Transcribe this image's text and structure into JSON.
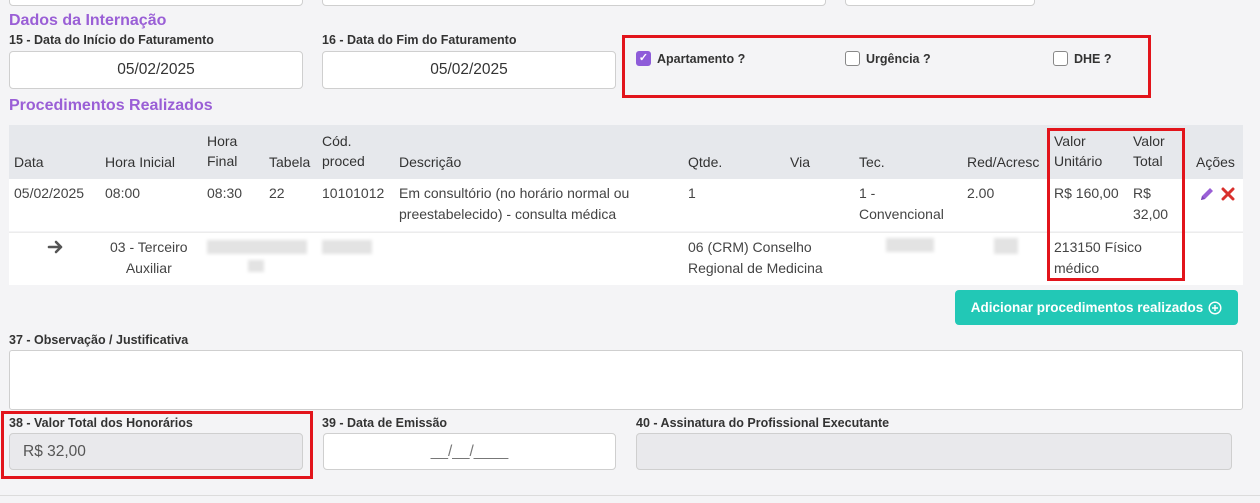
{
  "sections": {
    "internacao_title": "Dados da Internação",
    "procedimentos_title": "Procedimentos Realizados"
  },
  "fields": {
    "inicio_label": "15 - Data do Início do Faturamento",
    "inicio_value": "05/02/2025",
    "fim_label": "16 - Data do Fim do Faturamento",
    "fim_value": "05/02/2025",
    "obs_label": "37 - Observação / Justificativa",
    "obs_value": "",
    "valor_total_label": "38 - Valor Total dos Honorários",
    "valor_total_value": "R$ 32,00",
    "emissao_label": "39 - Data de Emissão",
    "emissao_value": "__/__/____",
    "assinatura_label": "40 - Assinatura do Profissional Executante",
    "assinatura_value": ""
  },
  "checkboxes": {
    "apartamento": {
      "label": "Apartamento ?",
      "checked": true
    },
    "urgencia": {
      "label": "Urgência ?",
      "checked": false
    },
    "dhe": {
      "label": "DHE ?",
      "checked": false
    }
  },
  "table": {
    "headers": {
      "data": "Data",
      "hora_inicial": "Hora Inicial",
      "hora_final_1": "Hora",
      "hora_final_2": "Final",
      "tabela": "Tabela",
      "cod_1": "Cód.",
      "cod_2": "proced",
      "descricao": "Descrição",
      "qtde": "Qtde.",
      "via": "Via",
      "tec": "Tec.",
      "red": "Red/Acresc",
      "valor_unit_1": "Valor",
      "valor_unit_2": "Unitário",
      "valor_total_1": "Valor",
      "valor_total_2": "Total",
      "acoes": "Ações"
    },
    "row": {
      "data": "05/02/2025",
      "hora_inicial": "08:00",
      "hora_final": "08:30",
      "tabela": "22",
      "cod": "10101012",
      "descricao_1": "Em consultório (no horário normal ou",
      "descricao_2": "preestabelecido) - consulta médica",
      "qtde": "1",
      "via": "",
      "tec_1": "1 -",
      "tec_2": "Convencional",
      "red": "2.00",
      "valor_unitario": "R$ 160,00",
      "valor_total_1": "R$",
      "valor_total_2": "32,00"
    },
    "subrow": {
      "grau_1": "03 - Terceiro",
      "grau_2": "Auxiliar",
      "conselho_1": "06 (CRM) Conselho",
      "conselho_2": "Regional de Medicina",
      "cbo_1": "213150 Físico",
      "cbo_2": "médico"
    }
  },
  "buttons": {
    "adicionar": "Adicionar procedimentos realizados"
  },
  "icons": {
    "edit": "pencil-icon",
    "delete": "close-icon",
    "arrow": "arrow-right-icon",
    "add": "plus-circle-icon"
  },
  "colors": {
    "accent_purple": "#9a5fd6",
    "button_teal": "#22c8b6",
    "highlight_red": "#e2141b",
    "delete_red": "#d9302c"
  }
}
